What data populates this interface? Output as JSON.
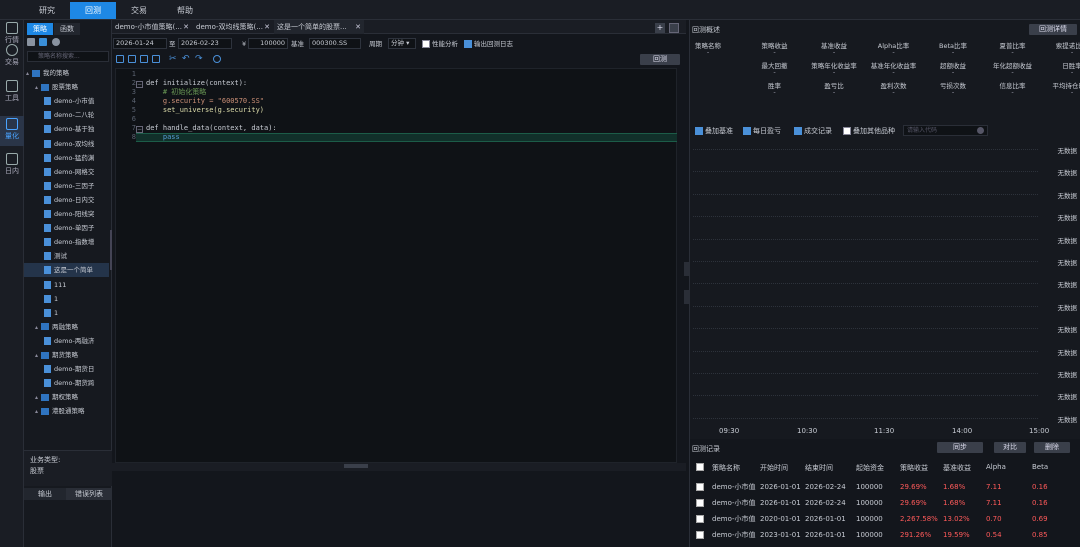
{
  "topmenu": [
    "研究",
    "回测",
    "交易",
    "帮助"
  ],
  "rail": [
    {
      "icon": "market-icon",
      "label": "行情"
    },
    {
      "icon": "trade-icon",
      "label": "交易"
    },
    {
      "icon": "tools-icon",
      "label": "工具"
    },
    {
      "icon": "quant-icon",
      "label": "量化"
    },
    {
      "icon": "calendar-icon",
      "label": "日内"
    }
  ],
  "filepanel": {
    "subtabs": [
      "策略",
      "函数"
    ],
    "search_placeholder": "策略名称搜索...",
    "tree": [
      {
        "level": 0,
        "type": "folder",
        "label": "我的策略"
      },
      {
        "level": 1,
        "type": "folder",
        "label": "股票策略"
      },
      {
        "level": 2,
        "type": "file",
        "label": "demo-小市值"
      },
      {
        "level": 2,
        "type": "file",
        "label": "demo-二八轮"
      },
      {
        "level": 2,
        "type": "file",
        "label": "demo-基于独"
      },
      {
        "level": 2,
        "type": "file",
        "label": "demo-双均线"
      },
      {
        "level": 2,
        "type": "file",
        "label": "demo-猛药渊"
      },
      {
        "level": 2,
        "type": "file",
        "label": "demo-网格交"
      },
      {
        "level": 2,
        "type": "file",
        "label": "demo-三因子"
      },
      {
        "level": 2,
        "type": "file",
        "label": "demo-日内交"
      },
      {
        "level": 2,
        "type": "file",
        "label": "demo-阳线突"
      },
      {
        "level": 2,
        "type": "file",
        "label": "demo-单因子"
      },
      {
        "level": 2,
        "type": "file",
        "label": "demo-指数增"
      },
      {
        "level": 2,
        "type": "file",
        "label": "测试"
      },
      {
        "level": 2,
        "type": "file",
        "label": "这是一个简单",
        "selected": true
      },
      {
        "level": 2,
        "type": "file",
        "label": "111"
      },
      {
        "level": 2,
        "type": "file",
        "label": "1"
      },
      {
        "level": 2,
        "type": "file",
        "label": "1"
      },
      {
        "level": 1,
        "type": "folder",
        "label": "两融策略"
      },
      {
        "level": 2,
        "type": "file",
        "label": "demo-两融济"
      },
      {
        "level": 1,
        "type": "folder",
        "label": "期货策略"
      },
      {
        "level": 2,
        "type": "file",
        "label": "demo-期货日"
      },
      {
        "level": 2,
        "type": "file",
        "label": "demo-期货跨"
      },
      {
        "level": 1,
        "type": "folder",
        "label": "期权策略"
      },
      {
        "level": 1,
        "type": "folder",
        "label": "港股通策略"
      }
    ],
    "biz_label": "业务类型:",
    "biz_value": "股票",
    "bottom_tabs": [
      "输出",
      "错误列表"
    ]
  },
  "editor": {
    "tabs": [
      "demo-小市值策略(...",
      "demo-双均线策略(...",
      "这是一个简单的股票..."
    ],
    "start_date": "2026-01-24",
    "to_label": "至",
    "end_date": "2026-02-23",
    "currency": "¥",
    "capital": "100000",
    "benchmark_label": "基准",
    "benchmark": "000300.SS",
    "period_label": "周期",
    "period": "分钟",
    "perf_label": "性能分析",
    "log_label": "输出回测日志",
    "run_label": "回测",
    "line_numbers": [
      "1",
      "2",
      "3",
      "4",
      "5",
      "6",
      "7",
      "8"
    ],
    "code": [
      "",
      "def initialize(context):",
      "    # 初始化策略",
      "    g.security = \"600570.SS\"",
      "    set_universe(g.security)",
      "",
      "def handle_data(context, data):",
      "    pass"
    ]
  },
  "right": {
    "title": "回测概述",
    "detail_button": "回测详情",
    "metrics_row1": [
      "策略名称",
      "策略收益",
      "基准收益",
      "Alpha比率",
      "Beta比率",
      "夏普比率",
      "索提诺比率"
    ],
    "metrics_row2": [
      "",
      "最大回撤",
      "策略年化收益率",
      "基准年化收益率",
      "超额收益",
      "年化超额收益",
      "日胜率"
    ],
    "metrics_row3": [
      "",
      "胜率",
      "盈亏比",
      "盈利次数",
      "亏损次数",
      "信息比率",
      "平均持仓时长"
    ],
    "placeholder_value": "-",
    "checks": [
      {
        "label": "叠加基准",
        "on": true
      },
      {
        "label": "每日盈亏",
        "on": true
      },
      {
        "label": "成交记录",
        "on": true
      },
      {
        "label": "叠加其他品种",
        "on": false
      }
    ],
    "search_placeholder": "请输入代码",
    "nodata": "无数据",
    "xticks": [
      "09:30",
      "10:30",
      "11:30",
      "14:00",
      "15:00"
    ],
    "records_title": "回测记录",
    "record_buttons": [
      "同步",
      "对比",
      "删除"
    ],
    "columns": [
      "策略名称",
      "开始时间",
      "结束时间",
      "起始资金",
      "策略收益",
      "基准收益",
      "Alpha",
      "Beta"
    ],
    "rows": [
      [
        "demo-小市值",
        "2026-01-01",
        "2026-02-24",
        "100000",
        "29.69%",
        "1.68%",
        "7.11",
        "0.16"
      ],
      [
        "demo-小市值",
        "2026-01-01",
        "2026-02-24",
        "100000",
        "29.69%",
        "1.68%",
        "7.11",
        "0.16"
      ],
      [
        "demo-小市值",
        "2020-01-01",
        "2026-01-01",
        "100000",
        "2,267.58%",
        "13.02%",
        "0.70",
        "0.69"
      ],
      [
        "demo-小市值",
        "2023-01-01",
        "2026-01-01",
        "100000",
        "291.26%",
        "19.59%",
        "0.54",
        "0.85"
      ]
    ]
  }
}
